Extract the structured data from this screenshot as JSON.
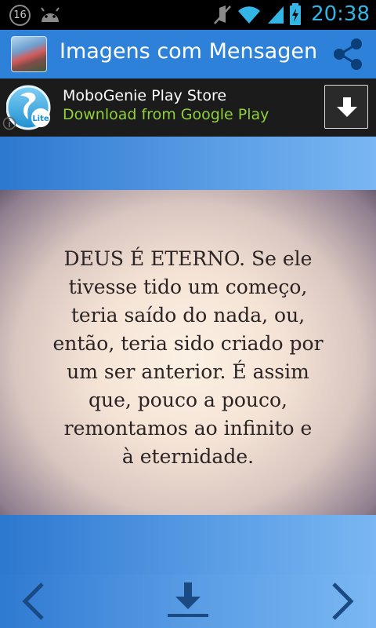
{
  "status_bar": {
    "notification_count": "16",
    "time": "20:38",
    "icons": [
      "android-icon",
      "mute-icon",
      "wifi-icon",
      "signal-icon",
      "battery-charging-icon"
    ]
  },
  "action_bar": {
    "title": "Imagens com Mensagen",
    "app_icon": "app-logo-icon",
    "share_icon": "share-icon"
  },
  "ad": {
    "title": "MoboGenie Play Store",
    "subtitle": "Download from Google Play",
    "logo_badge": "Lite",
    "download_icon": "download-arrow-icon",
    "subtitle_color": "#8fd13b"
  },
  "message": {
    "lines": [
      "DEUS É ETERNO. Se ele",
      "tivesse tido um começo,",
      "teria saído do nada, ou,",
      "então, teria sido criado por",
      "um ser anterior. É assim",
      "que, pouco a pouco,",
      "remontamos ao infinito e",
      "à eternidade."
    ]
  },
  "bottom_nav": {
    "prev_icon": "chevron-left-icon",
    "download_icon": "download-icon",
    "next_icon": "chevron-right-icon"
  },
  "colors": {
    "accent": "#33b5e5",
    "action_bar": "#2d81d8",
    "ad_background": "#1b1b1b"
  }
}
